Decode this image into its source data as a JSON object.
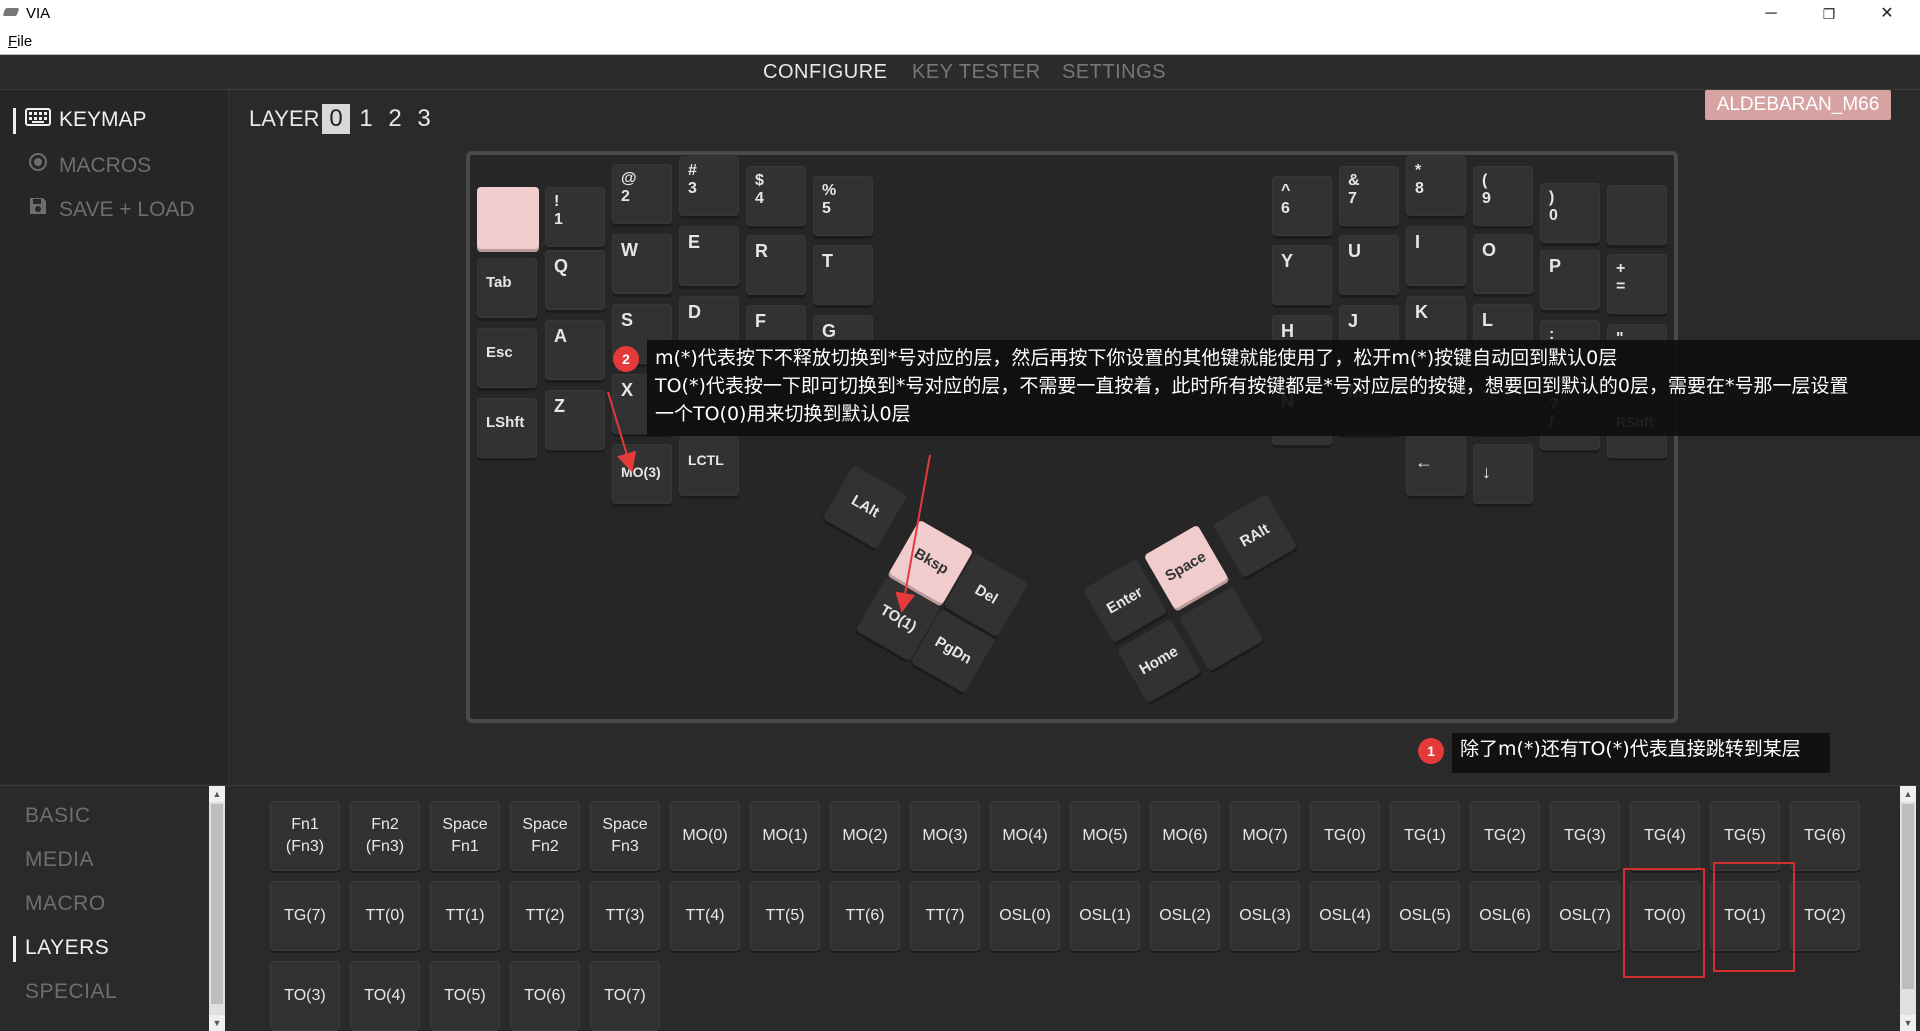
{
  "window": {
    "title": "VIA",
    "menu_file": "File",
    "minimize": "─",
    "maximize": "❐",
    "close": "✕"
  },
  "topnav": {
    "configure": "CONFIGURE",
    "key_tester": "KEY TESTER",
    "settings": "SETTINGS"
  },
  "sidebar": {
    "keymap": "KEYMAP",
    "macros": "MACROS",
    "save_load": "SAVE + LOAD"
  },
  "layers": {
    "label": "LAYER",
    "items": [
      "0",
      "1",
      "2",
      "3"
    ],
    "active": "0"
  },
  "keyboard_name": "ALDEBARAN_M66",
  "keys": {
    "k1": "!\n1",
    "k2": "@\n2",
    "k3": "#\n3",
    "k4": "$\n4",
    "k5": "%\n5",
    "tab": "Tab",
    "q": "Q",
    "w": "W",
    "e": "E",
    "r": "R",
    "t": "T",
    "esc": "Esc",
    "a": "A",
    "s": "S",
    "d": "D",
    "f": "F",
    "g": "G",
    "lshft": "LShft",
    "z": "Z",
    "x": "X",
    "mo3": "MO(3)",
    "lctl": "LCTL",
    "k6": "^\n6",
    "k7": "&\n7",
    "k8": "*\n8",
    "k9": "(\n9",
    "k0": ")\n0",
    "y": "Y",
    "u": "U",
    "i": "I",
    "o": "O",
    "p": "P",
    "eq": "+\n=",
    "h": "H",
    "j": "J",
    "k": "K",
    "l": "L",
    "n": "N",
    "m": "M",
    "comma": ",",
    "period": ".",
    "slash": "?\n/",
    "quote": "\"",
    "semi": ":",
    "rshft": "RShft",
    "left": "←",
    "down": "↓",
    "lalt": "LAlt",
    "bksp": "Bksp",
    "del": "Del",
    "to1": "TO(1)",
    "pgdn": "PgDn",
    "enter": "Enter",
    "space": "Space",
    "ralt": "RAlt",
    "home": "Home"
  },
  "annotations": {
    "badge1": "1",
    "note1": "除了m(*)还有TO(*)代表直接跳转到某层",
    "badge2": "2",
    "note2_line1": "m(*)代表按下不释放切换到*号对应的层，然后再按下你设置的其他键就能使用了，松开m(*)按键自动回到默认0层",
    "note2_line2": "TO(*)代表按一下即可切换到*号对应的层，不需要一直按着，此时所有按键都是*号对应层的按键，想要回到默认的0层，需要在*号那一层设置",
    "note2_line3": "一个TO(0)用来切换到默认0层"
  },
  "categories": {
    "basic": "BASIC",
    "media": "MEDIA",
    "macro": "MACRO",
    "layers": "LAYERS",
    "special": "SPECIAL"
  },
  "palette": {
    "row1": [
      "Fn1\n(Fn3)",
      "Fn2\n(Fn3)",
      "Space\nFn1",
      "Space\nFn2",
      "Space\nFn3",
      "MO(0)",
      "MO(1)",
      "MO(2)",
      "MO(3)",
      "MO(4)",
      "MO(5)",
      "MO(6)",
      "MO(7)",
      "TG(0)",
      "TG(1)",
      "TG(2)",
      "TG(3)",
      "TG(4)",
      "TG(5)",
      "TG(6)"
    ],
    "row2": [
      "TG(7)",
      "TT(0)",
      "TT(1)",
      "TT(2)",
      "TT(3)",
      "TT(4)",
      "TT(5)",
      "TT(6)",
      "TT(7)",
      "OSL(0)",
      "OSL(1)",
      "OSL(2)",
      "OSL(3)",
      "OSL(4)",
      "OSL(5)",
      "OSL(6)",
      "OSL(7)",
      "TO(0)",
      "TO(1)",
      "TO(2)"
    ],
    "row3": [
      "TO(3)",
      "TO(4)",
      "TO(5)",
      "TO(6)",
      "TO(7)"
    ]
  },
  "scroll_arrows": {
    "up": "▲",
    "down": "▼"
  },
  "colors": {
    "accent_pink": "#f0cccc",
    "badge_bg": "#d7a2a2",
    "annotation_red": "#e53a3a"
  }
}
